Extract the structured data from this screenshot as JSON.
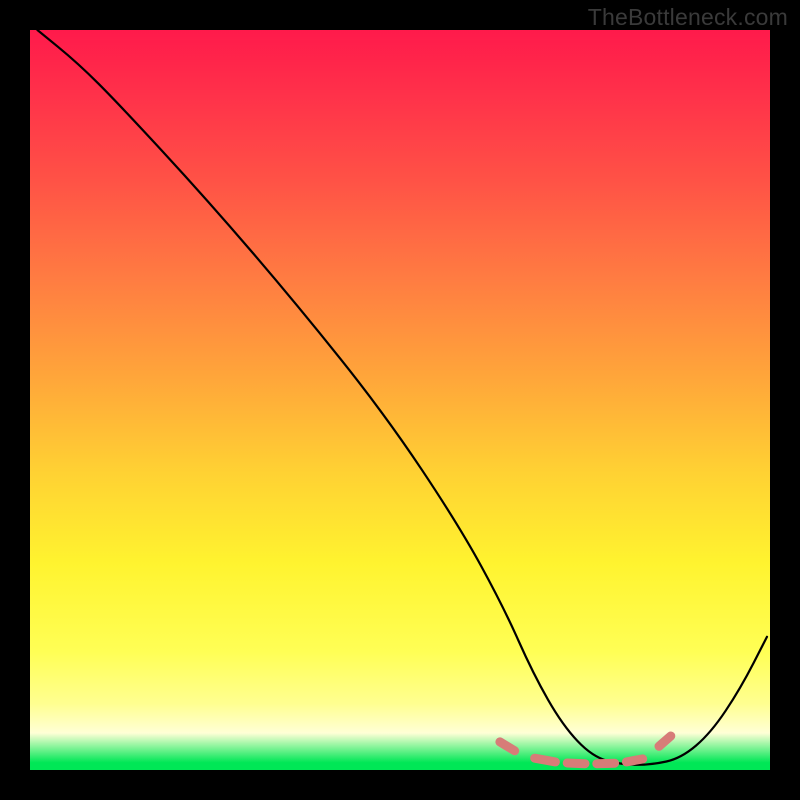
{
  "attribution": "TheBottleneck.com",
  "colors": {
    "page_bg": "#000000",
    "gradient_top": "#ff1a4b",
    "gradient_bottom": "#00e756",
    "curve_stroke": "#000000",
    "dash_stroke": "#d77c78"
  },
  "chart_data": {
    "type": "line",
    "title": "",
    "xlabel": "",
    "ylabel": "",
    "xlim": [
      0,
      100
    ],
    "ylim": [
      0,
      100
    ],
    "grid": false,
    "legend": false,
    "note": "No numeric axes/ticks rendered in source; x/y are normalized 0–100. Curve values estimated from pixel positions.",
    "series": [
      {
        "name": "curve",
        "x": [
          1,
          6.5,
          12,
          24,
          36,
          48,
          58,
          64,
          68,
          72,
          76,
          80,
          84,
          88,
          92,
          96,
          99.6
        ],
        "values": [
          100,
          95.5,
          90,
          77,
          63,
          48,
          33,
          22,
          13,
          6,
          1.8,
          0.7,
          0.7,
          1.6,
          5,
          11,
          18
        ]
      }
    ],
    "highlight_dashes": {
      "note": "short segments on the curve near the trough",
      "segments": [
        {
          "x1": 63.5,
          "y1": 3.8,
          "x2": 65.5,
          "y2": 2.6
        },
        {
          "x1": 68.2,
          "y1": 1.6,
          "x2": 71.0,
          "y2": 1.1
        },
        {
          "x1": 72.6,
          "y1": 0.95,
          "x2": 75.0,
          "y2": 0.85
        },
        {
          "x1": 76.6,
          "y1": 0.85,
          "x2": 79.0,
          "y2": 0.92
        },
        {
          "x1": 80.6,
          "y1": 1.1,
          "x2": 82.8,
          "y2": 1.5
        },
        {
          "x1": 85.0,
          "y1": 3.2,
          "x2": 86.6,
          "y2": 4.6
        }
      ]
    }
  }
}
